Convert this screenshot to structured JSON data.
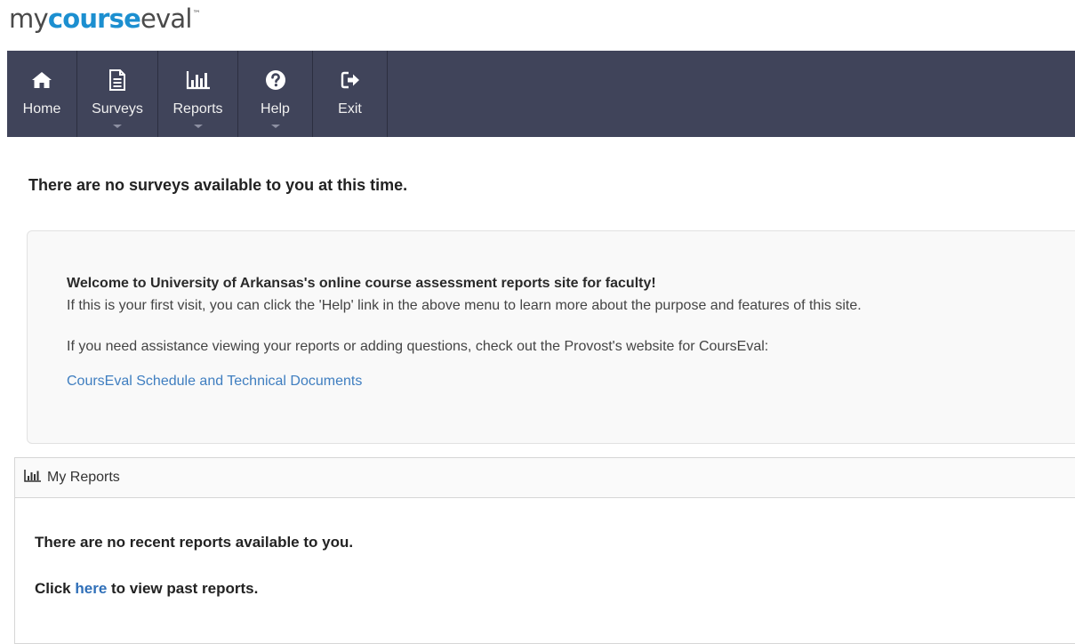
{
  "logo": {
    "prefix": "my",
    "accent": "course",
    "suffix": "eval",
    "tm": "™"
  },
  "nav": {
    "items": [
      {
        "label": "Home"
      },
      {
        "label": "Surveys"
      },
      {
        "label": "Reports"
      },
      {
        "label": "Help"
      },
      {
        "label": "Exit"
      }
    ]
  },
  "main": {
    "no_surveys": "There are no surveys available to you at this time."
  },
  "welcome": {
    "title": "Welcome to University of Arkansas's online course assessment reports site for faculty!",
    "p1": "If this is your first visit, you can click the 'Help' link in the above menu to learn more about the purpose and features of this site.",
    "p2": "If you need assistance viewing your reports or adding questions, check out the Provost's website for CoursEval:",
    "link": "CoursEval Schedule and Technical Documents"
  },
  "reports": {
    "title": "My Reports",
    "no_recent": "There are no recent reports available to you.",
    "click_prefix": "Click ",
    "click_link": "here",
    "click_suffix": " to view past reports."
  },
  "colors": {
    "navbar": "#40445a",
    "logo_accent": "#1c8fd0",
    "link": "#3f7ec0"
  }
}
